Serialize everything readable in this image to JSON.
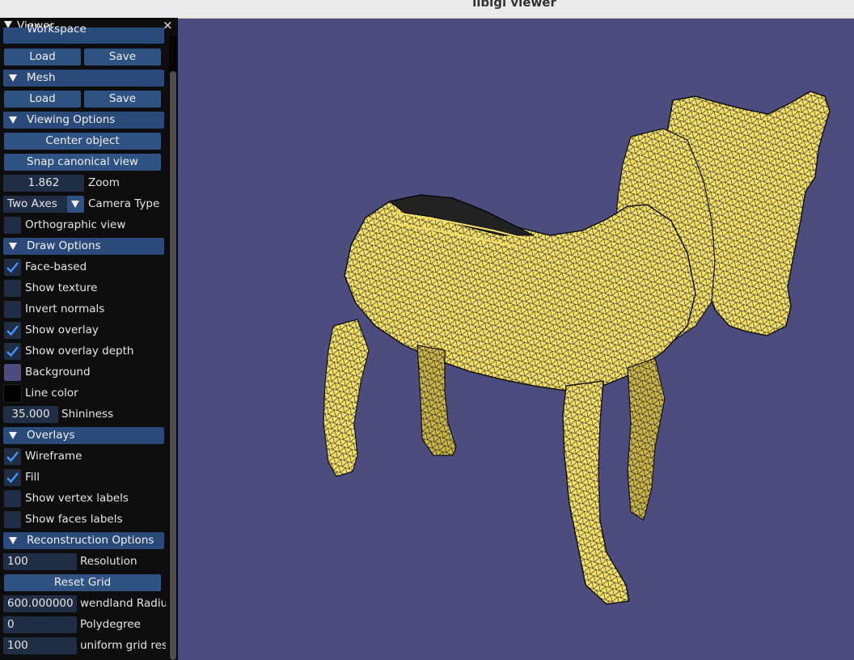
{
  "window": {
    "title": "libigl viewer"
  },
  "panel": {
    "title": "Viewer",
    "close_glyph": "×",
    "sections": {
      "workspace": {
        "label": "Workspace",
        "load": "Load",
        "save": "Save"
      },
      "mesh": {
        "label": "Mesh",
        "load": "Load",
        "save": "Save"
      },
      "viewing": {
        "label": "Viewing Options",
        "center": "Center object",
        "snap": "Snap canonical view",
        "zoom_value": "1.862",
        "zoom_label": "Zoom",
        "camera_value": "Two Axes",
        "camera_label": "Camera Type",
        "ortho_label": "Orthographic view"
      },
      "draw": {
        "label": "Draw Options",
        "face_based": "Face-based",
        "show_texture": "Show texture",
        "invert_normals": "Invert normals",
        "show_overlay": "Show overlay",
        "show_overlay_depth": "Show overlay depth",
        "background": "Background",
        "line_color": "Line color",
        "shininess_value": "35.000",
        "shininess_label": "Shininess"
      },
      "overlays": {
        "label": "Overlays",
        "wireframe": "Wireframe",
        "fill": "Fill",
        "vertex_labels": "Show vertex labels",
        "faces_labels": "Show faces labels"
      },
      "reconstruction": {
        "label": "Reconstruction Options",
        "resolution_value": "100",
        "resolution_label": "Resolution",
        "reset_grid": "Reset Grid",
        "wendland_value": "600.000000",
        "wendland_label": "wendland Radius",
        "polydegree_value": "0",
        "polydegree_label": "Polydegree",
        "uniform_value": "100",
        "uniform_label": "uniform grid resolution"
      }
    }
  },
  "checks": {
    "face_based": true,
    "show_texture": false,
    "invert_normals": false,
    "show_overlay": true,
    "show_overlay_depth": true,
    "ortho": false,
    "wireframe": true,
    "fill": true,
    "vertex_labels": false,
    "faces_labels": false
  },
  "colors": {
    "background": "#4d4c7f",
    "line_color": "#000000",
    "mesh_fill": "#f5e06a",
    "header_bg": "#2a4a7a",
    "button_bg": "#2e5282",
    "check_mark": "#4296fa"
  },
  "viewport": {
    "model": "horse-mesh"
  }
}
